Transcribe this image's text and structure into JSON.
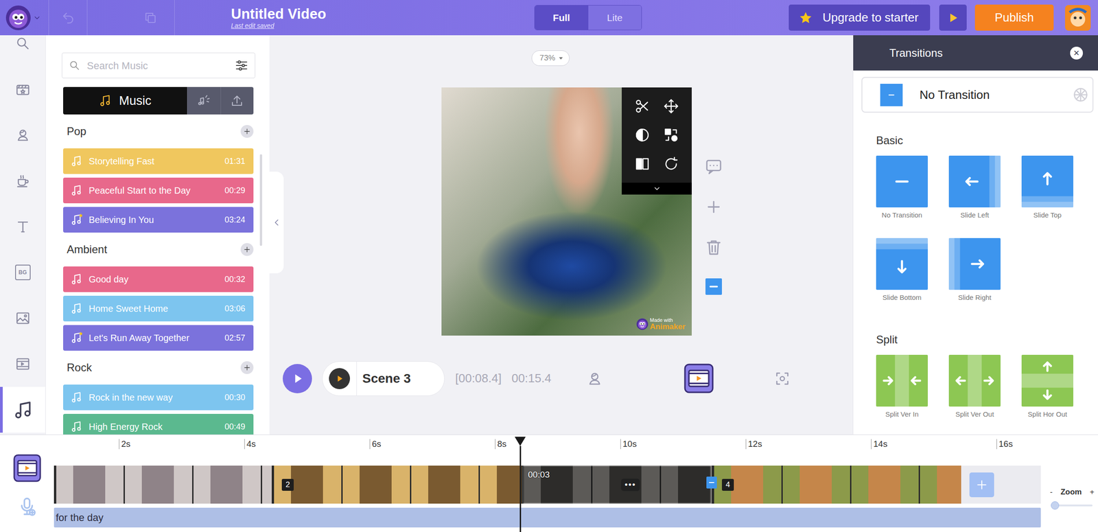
{
  "window": {
    "title": "Untitled Video",
    "subtitle": "Last edit saved"
  },
  "header": {
    "history": [
      {
        "kind": "undo",
        "disabled": true
      },
      {
        "kind": "duplicate",
        "disabled": true
      }
    ],
    "modes": [
      {
        "label": "Full",
        "selected": true
      },
      {
        "label": "Lite",
        "selected": false
      }
    ],
    "upgrade": "Upgrade to starter",
    "publish": "Publish"
  },
  "rail": [
    {
      "kind": "search",
      "selected": false
    },
    {
      "kind": "scene",
      "selected": false
    },
    {
      "kind": "character",
      "selected": false
    },
    {
      "kind": "props",
      "selected": false
    },
    {
      "kind": "text",
      "selected": false
    },
    {
      "kind": "background",
      "label": "BG",
      "selected": false
    },
    {
      "kind": "image",
      "selected": false
    },
    {
      "kind": "video",
      "selected": false
    },
    {
      "kind": "music",
      "selected": true
    }
  ],
  "music": {
    "search": {
      "placeholder": "Search Music"
    },
    "tabs": [
      {
        "kind": "library",
        "label": "Music",
        "selected": true
      },
      {
        "kind": "effects",
        "selected": false
      },
      {
        "kind": "upload",
        "selected": false
      }
    ],
    "categories": [
      {
        "name": "Pop",
        "tracks": [
          {
            "title": "Storytelling Fast",
            "duration": "01:31",
            "color": "#f0c75e",
            "premium": false
          },
          {
            "title": "Peaceful Start to the Day",
            "duration": "00:29",
            "color": "#e8688b",
            "premium": false
          },
          {
            "title": "Believing In You",
            "duration": "03:24",
            "color": "#7b72dc",
            "premium": true
          }
        ]
      },
      {
        "name": "Ambient",
        "tracks": [
          {
            "title": "Good day",
            "duration": "00:32",
            "color": "#e8688b",
            "premium": false
          },
          {
            "title": "Home Sweet Home",
            "duration": "03:06",
            "color": "#7dc5ef",
            "premium": false
          },
          {
            "title": "Let's Run Away Together",
            "duration": "02:57",
            "color": "#7b72dc",
            "premium": true
          }
        ]
      },
      {
        "name": "Rock",
        "tracks": [
          {
            "title": "Rock in the new way",
            "duration": "00:30",
            "color": "#7dc5ef",
            "premium": false
          },
          {
            "title": "High Energy Rock",
            "duration": "00:49",
            "color": "#5bb98f",
            "premium": false
          }
        ]
      }
    ]
  },
  "canvas": {
    "zoom": "73%",
    "watermark": {
      "line1": "Made with",
      "line2": "Animaker"
    }
  },
  "scene_bar": {
    "scene": "Scene 3",
    "current_time": "[00:08.4]",
    "total_time": "00:15.4",
    "views": [
      {
        "kind": "character",
        "selected": false
      },
      {
        "kind": "video",
        "selected": true
      },
      {
        "kind": "focus",
        "selected": false
      }
    ]
  },
  "transitions": {
    "title": "Transitions",
    "close": "×",
    "current": {
      "label": "No Transition",
      "kind": "none"
    },
    "groups": [
      {
        "name": "Basic",
        "color": "#3d95ee",
        "items": [
          {
            "label": "No Transition",
            "kind": "none"
          },
          {
            "label": "Slide Left",
            "kind": "slide-left"
          },
          {
            "label": "Slide Top",
            "kind": "slide-top"
          },
          {
            "label": "Slide Bottom",
            "kind": "slide-bottom"
          },
          {
            "label": "Slide Right",
            "kind": "slide-right"
          }
        ]
      },
      {
        "name": "Split",
        "color": "#8dc753",
        "items": [
          {
            "label": "Split Ver In",
            "kind": "split-ver-in"
          },
          {
            "label": "Split Ver Out",
            "kind": "split-ver-out"
          },
          {
            "label": "Split Hor Out",
            "kind": "split-hor-out"
          }
        ]
      }
    ]
  },
  "timeline": {
    "ticks": [
      "2s",
      "4s",
      "6s",
      "8s",
      "10s",
      "12s",
      "14s",
      "16s"
    ],
    "scenes": [
      {
        "selected": false
      },
      {
        "badge": "2",
        "selected": false
      },
      {
        "duration": "00:03",
        "menu": "•••",
        "selected": true
      },
      {
        "badge": "4",
        "transition_marker": true,
        "selected": false
      }
    ],
    "audio": {
      "label": "for the day"
    },
    "zoom": {
      "minus": "-",
      "label": "Zoom",
      "plus": "+",
      "level": 0
    }
  }
}
